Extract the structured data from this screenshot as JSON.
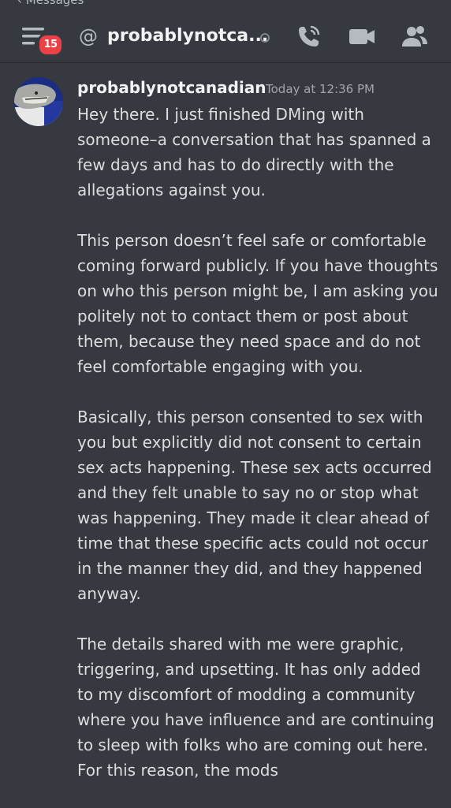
{
  "header": {
    "back_hint": "‹ Messages",
    "menu_icon": "hamburger-menu-icon",
    "unread_badge": "15",
    "at_symbol": "@",
    "channel_name": "probablynotca...",
    "icons": [
      "call-icon",
      "video-icon",
      "members-icon"
    ]
  },
  "message": {
    "author": "probablynotcanadian",
    "timestamp": "Today at 12:36 PM",
    "paragraphs": [
      "Hey there. I just finished DMing with someone–a conversation that has spanned a few days and has to do directly with the allegations against you.",
      "This person doesn’t feel safe or comfortable coming forward publicly. If you have thoughts on who this person might be, I am asking you politely not to contact them or post about them, because they need space and do not feel comfortable engaging with you.",
      "Basically, this person consented to sex with you but explicitly did not consent to certain sex acts happening. These sex acts occurred and they felt unable to say no or stop what was happening. They made it clear ahead of time that these specific acts could not occur in the manner they did, and they happened anyway.",
      "The details shared with me were graphic, triggering, and upsetting. It has only added to my discomfort of modding a community where you have influence and are continuing to sleep with folks who are coming out here. For this reason, the mods"
    ]
  },
  "colors": {
    "background": "#36393f",
    "text": "#dcddde",
    "badge": "#ed4245"
  }
}
